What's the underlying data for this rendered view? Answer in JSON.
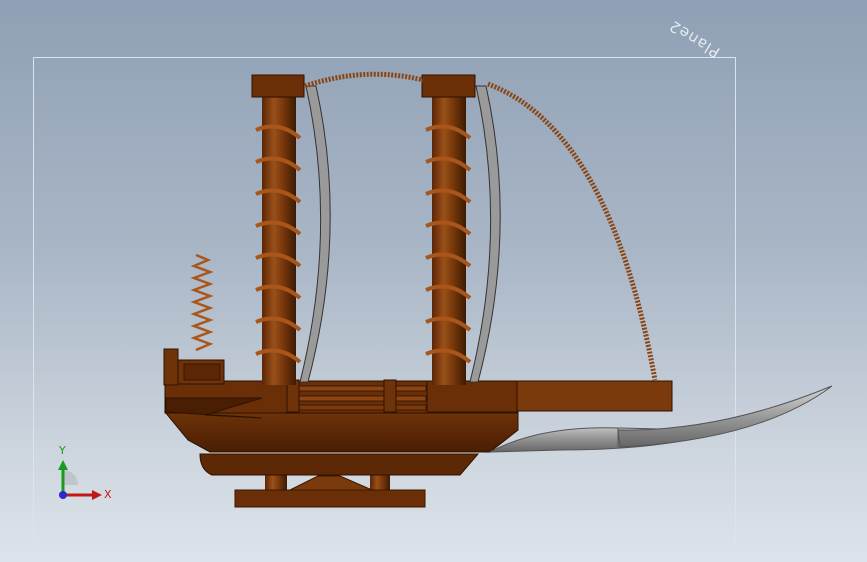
{
  "viewport": {
    "plane_label": "Plane2",
    "model_colors": {
      "wood": "#6b3108",
      "wood_dark": "#4a1f04",
      "wood_light": "#8a4512",
      "metal": "#8c8c8c",
      "metal_light": "#c8c8c8"
    }
  },
  "triad": {
    "x_label": "X",
    "y_label": "Y",
    "colors": {
      "x": "#c01818",
      "y": "#1a9a1a",
      "z": "#2a2acc"
    }
  }
}
